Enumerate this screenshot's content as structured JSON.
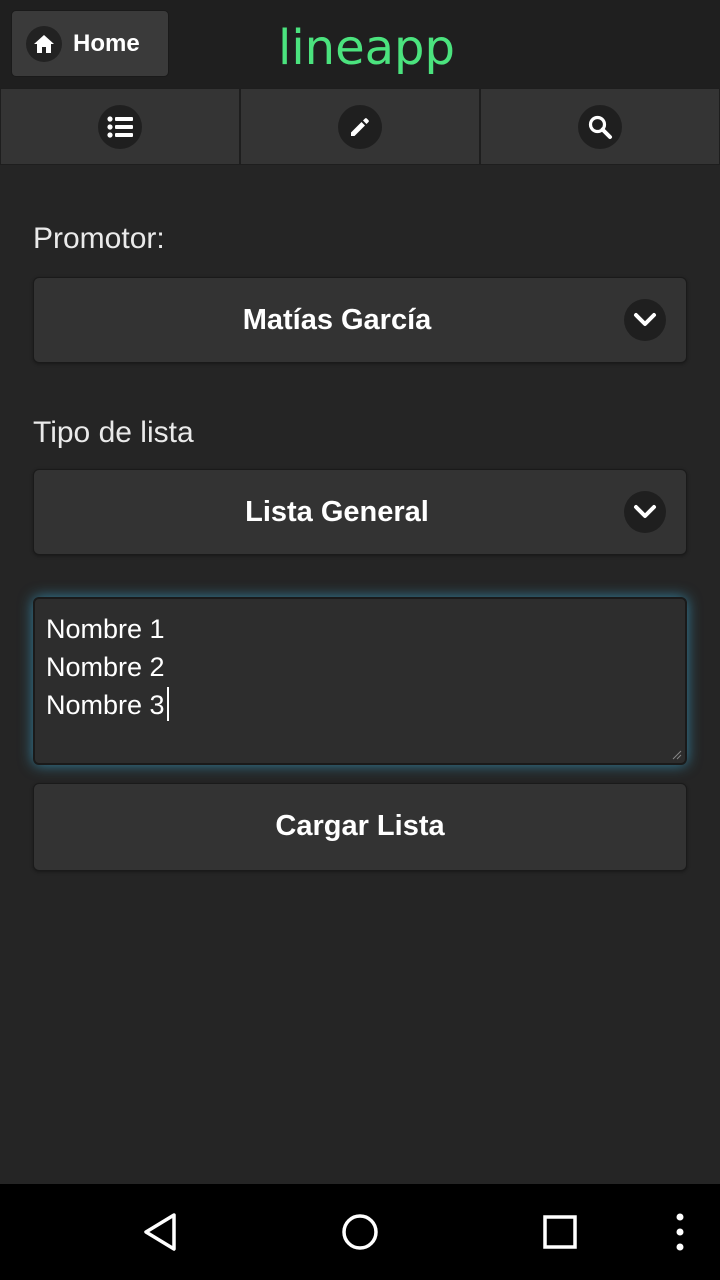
{
  "header": {
    "home_label": "Home",
    "app_title": "lineapp"
  },
  "navbar": {
    "items": [
      {
        "icon": "list-icon"
      },
      {
        "icon": "pencil-icon"
      },
      {
        "icon": "search-icon"
      }
    ]
  },
  "form": {
    "promotor_label": "Promotor:",
    "promotor_value": "Matías García",
    "tipo_label": "Tipo de lista",
    "tipo_value": "Lista General",
    "names_lines": [
      "Nombre 1",
      "Nombre 2",
      "Nombre 3"
    ],
    "submit_label": "Cargar Lista"
  },
  "colors": {
    "accent_title": "#4be37e",
    "focus_glow": "#38a0c8",
    "background": "#252525"
  },
  "system_nav": {
    "icons": [
      "back-icon",
      "home-circle-icon",
      "recents-icon",
      "overflow-menu-icon"
    ]
  }
}
